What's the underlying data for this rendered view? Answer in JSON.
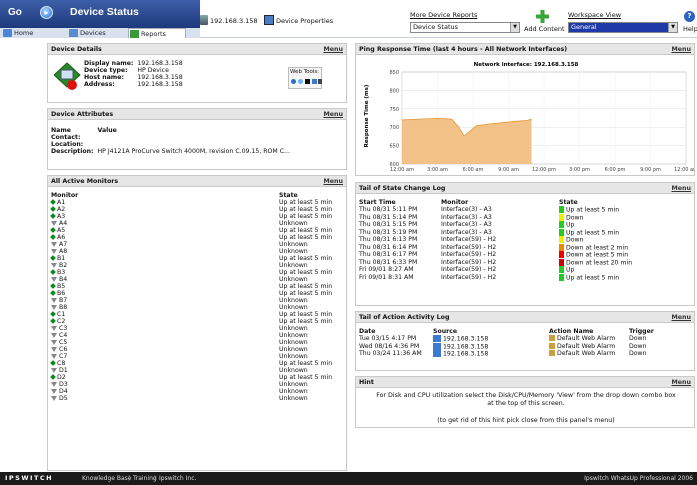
{
  "header": {
    "go_label": "Go",
    "title": "Device Status",
    "device_ip": "192.168.3.158",
    "device_properties": "Device Properties",
    "more_reports_label": "More Device Reports",
    "report_select": "Device Status",
    "add_content": "Add Content",
    "workspace_label": "Workspace View",
    "workspace_select": "General",
    "help": "Help"
  },
  "tabs": [
    {
      "label": "Home"
    },
    {
      "label": "Devices"
    },
    {
      "label": "Reports"
    }
  ],
  "device_details": {
    "title": "Device Details",
    "menu": "Menu",
    "fields": [
      {
        "label": "Display name:",
        "value": "192.168.3.158"
      },
      {
        "label": "Device type:",
        "value": "HP Device"
      },
      {
        "label": "Host name:",
        "value": "192.168.3.158"
      },
      {
        "label": "Address:",
        "value": "192.168.3.158"
      }
    ],
    "web_tools_label": "Web Tools:"
  },
  "device_attributes": {
    "title": "Device Attributes",
    "menu": "Menu",
    "col_name": "Name",
    "col_value": "Value",
    "rows": [
      {
        "name": "Contact:",
        "value": ""
      },
      {
        "name": "Location:",
        "value": ""
      },
      {
        "name": "Description:",
        "value": "HP J4121A ProCurve Switch 4000M, revision C.09.15, ROM C..."
      }
    ]
  },
  "monitors": {
    "title": "All Active Monitors",
    "menu": "Menu",
    "col_monitor": "Monitor",
    "col_state": "State",
    "rows": [
      {
        "name": "A1",
        "up": true,
        "state": "Up at least 5 min"
      },
      {
        "name": "A2",
        "up": true,
        "state": "Up at least 5 min"
      },
      {
        "name": "A3",
        "up": true,
        "state": "Up at least 5 min"
      },
      {
        "name": "A4",
        "up": false,
        "state": "Unknown"
      },
      {
        "name": "A5",
        "up": true,
        "state": "Up at least 5 min"
      },
      {
        "name": "A6",
        "up": true,
        "state": "Up at least 5 min"
      },
      {
        "name": "A7",
        "up": false,
        "state": "Unknown"
      },
      {
        "name": "A8",
        "up": false,
        "state": "Unknown"
      },
      {
        "name": "B1",
        "up": true,
        "state": "Up at least 5 min"
      },
      {
        "name": "B2",
        "up": false,
        "state": "Unknown"
      },
      {
        "name": "B3",
        "up": true,
        "state": "Up at least 5 min"
      },
      {
        "name": "B4",
        "up": false,
        "state": "Unknown"
      },
      {
        "name": "B5",
        "up": true,
        "state": "Up at least 5 min"
      },
      {
        "name": "B6",
        "up": true,
        "state": "Up at least 5 min"
      },
      {
        "name": "B7",
        "up": false,
        "state": "Unknown"
      },
      {
        "name": "B8",
        "up": false,
        "state": "Unknown"
      },
      {
        "name": "C1",
        "up": true,
        "state": "Up at least 5 min"
      },
      {
        "name": "C2",
        "up": true,
        "state": "Up at least 5 min"
      },
      {
        "name": "C3",
        "up": false,
        "state": "Unknown"
      },
      {
        "name": "C4",
        "up": false,
        "state": "Unknown"
      },
      {
        "name": "C5",
        "up": false,
        "state": "Unknown"
      },
      {
        "name": "C6",
        "up": false,
        "state": "Unknown"
      },
      {
        "name": "C7",
        "up": false,
        "state": "Unknown"
      },
      {
        "name": "C8",
        "up": true,
        "state": "Up at least 5 min"
      },
      {
        "name": "D1",
        "up": false,
        "state": "Unknown"
      },
      {
        "name": "D2",
        "up": true,
        "state": "Up at least 5 min"
      },
      {
        "name": "D3",
        "up": false,
        "state": "Unknown"
      },
      {
        "name": "D4",
        "up": false,
        "state": "Unknown"
      },
      {
        "name": "D5",
        "up": false,
        "state": "Unknown"
      }
    ]
  },
  "ping_chart": {
    "title": "Ping Response Time (last 4 hours - All Network Interfaces)",
    "menu": "Menu"
  },
  "chart_data": {
    "type": "area",
    "title": "Network interface: 192.168.3.158",
    "ylabel": "Response Time (ms)",
    "xlabel": "",
    "ylim": [
      600,
      850
    ],
    "yticks": [
      600,
      650,
      700,
      750,
      800,
      850
    ],
    "categories": [
      "12:00 am",
      "3:00 am",
      "6:00 am",
      "9:00 am",
      "12:00 pm",
      "3:00 pm",
      "6:00 pm",
      "9:00 pm",
      "12:00 am"
    ],
    "x": [
      0,
      0.5,
      1,
      1.4,
      1.6,
      1.75,
      1.9,
      2.1,
      2.4,
      2.8,
      3.2,
      3.5,
      3.65
    ],
    "values": [
      720,
      722,
      724,
      722,
      700,
      676,
      688,
      704,
      708,
      712,
      716,
      718,
      722
    ],
    "grid": true,
    "fill_color": "#f1b774",
    "line_color": "#e8922e"
  },
  "state_log": {
    "title": "Tail of State Change Log",
    "menu": "Menu",
    "col_time": "Start Time",
    "col_monitor": "Monitor",
    "col_state": "State",
    "rows": [
      {
        "time": "Thu 08/31 5:11 PM",
        "monitor": "Interface(3) - A3",
        "state": "Up at least 5 min",
        "color": "#22cc22"
      },
      {
        "time": "Thu 08/31 5:14 PM",
        "monitor": "Interface(3) - A3",
        "state": "Down",
        "color": "#eeee00"
      },
      {
        "time": "Thu 08/31 5:15 PM",
        "monitor": "Interface(3) - A3",
        "state": "Up",
        "color": "#22cc22"
      },
      {
        "time": "Thu 08/31 5:19 PM",
        "monitor": "Interface(3) - A3",
        "state": "Up at least 5 min",
        "color": "#22cc22"
      },
      {
        "time": "Thu 08/31 6:13 PM",
        "monitor": "Interface(59) - H2",
        "state": "Down",
        "color": "#eeee00"
      },
      {
        "time": "Thu 08/31 6:14 PM",
        "monitor": "Interface(59) - H2",
        "state": "Down at least 2 min",
        "color": "#ee8800"
      },
      {
        "time": "Thu 08/31 6:17 PM",
        "monitor": "Interface(59) - H2",
        "state": "Down at least 5 min",
        "color": "#ee0000"
      },
      {
        "time": "Thu 08/31 6:33 PM",
        "monitor": "Interface(59) - H2",
        "state": "Down at least 20 min",
        "color": "#cc0000"
      },
      {
        "time": "Fri 09/01 8:27 AM",
        "monitor": "Interface(59) - H2",
        "state": "Up",
        "color": "#22cc22"
      },
      {
        "time": "Fri 09/01 8:31 AM",
        "monitor": "Interface(59) - H2",
        "state": "Up at least 5 min",
        "color": "#22cc22"
      }
    ]
  },
  "action_log": {
    "title": "Tail of Action Activity Log",
    "menu": "Menu",
    "col_date": "Date",
    "col_source": "Source",
    "col_action": "Action Name",
    "col_trigger": "Trigger",
    "rows": [
      {
        "date": "Tue 03/15 4:17 PM",
        "source": "192.168.3.158",
        "action": "Default Web Alarm",
        "trigger": "Down"
      },
      {
        "date": "Wed 08/16 4:36 PM",
        "source": "192.168.3.158",
        "action": "Default Web Alarm",
        "trigger": "Down"
      },
      {
        "date": "Thu 03/24 11:36 AM",
        "source": "192.168.3.158",
        "action": "Default Web Alarm",
        "trigger": "Down"
      }
    ]
  },
  "hint": {
    "title": "Hint",
    "menu": "Menu",
    "text1": "For Disk and CPU utilization select the Disk/CPU/Memory 'View' from the drop down combo box at the top of this screen.",
    "text2": "(to get rid of this hint pick close from this panel's menu)"
  },
  "footer": {
    "brand": "IPSWITCH",
    "links": [
      "Knowledge Base",
      "Training",
      "Ipswitch Inc."
    ],
    "product": "Ipswitch WhatsUp Professional 2006"
  }
}
